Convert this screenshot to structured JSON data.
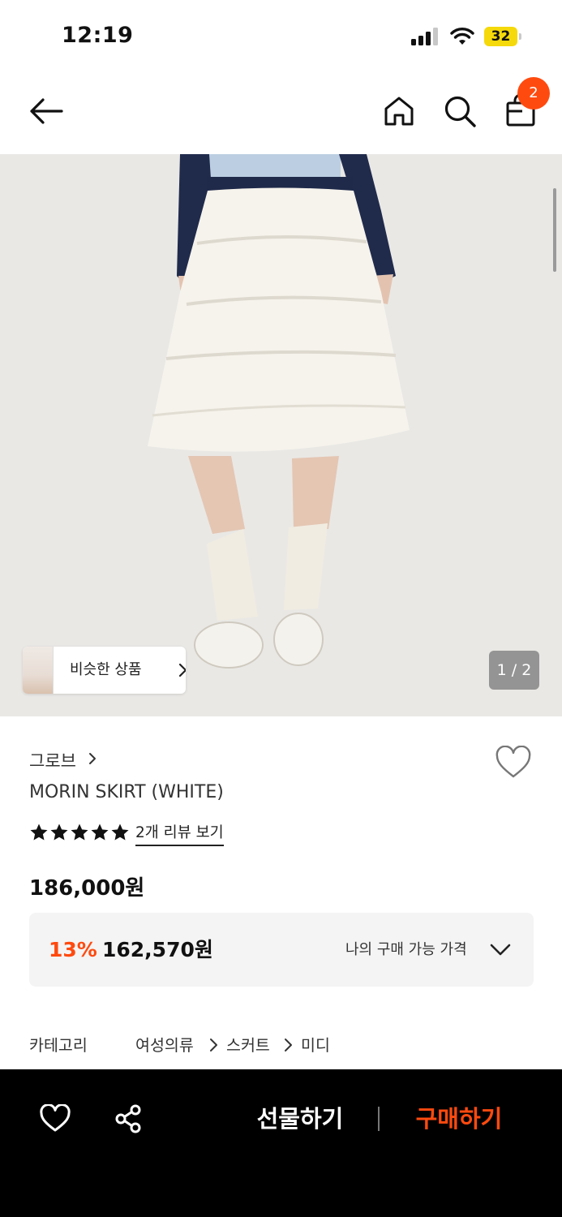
{
  "status_bar": {
    "time": "12:19",
    "battery": "32"
  },
  "nav": {
    "cart_count": "2"
  },
  "gallery": {
    "similar_label": "비슷한 상품",
    "page_indicator": "1 / 2"
  },
  "product": {
    "brand": "그로브",
    "title": "MORIN SKIRT (WHITE)",
    "rating_stars": 5,
    "review_link": "2개 리뷰 보기",
    "price": "186,000원",
    "discount_rate": "13%",
    "discount_price": "162,570원",
    "my_price_label": "나의 구매 가능 가격"
  },
  "category": {
    "label": "카테고리",
    "path": [
      "여성의류",
      "스커트",
      "미디"
    ]
  },
  "bottom_bar": {
    "gift_label": "선물하기",
    "buy_label": "구매하기"
  },
  "colors": {
    "accent": "#ff4a0f",
    "bottom_bar_bg": "#000000",
    "battery": "#f5d90a"
  },
  "icons": [
    "back-arrow-icon",
    "home-icon",
    "search-icon",
    "shopping-bag-icon",
    "heart-icon",
    "share-icon",
    "star-icon",
    "chevron-right-icon",
    "chevron-down-icon"
  ]
}
